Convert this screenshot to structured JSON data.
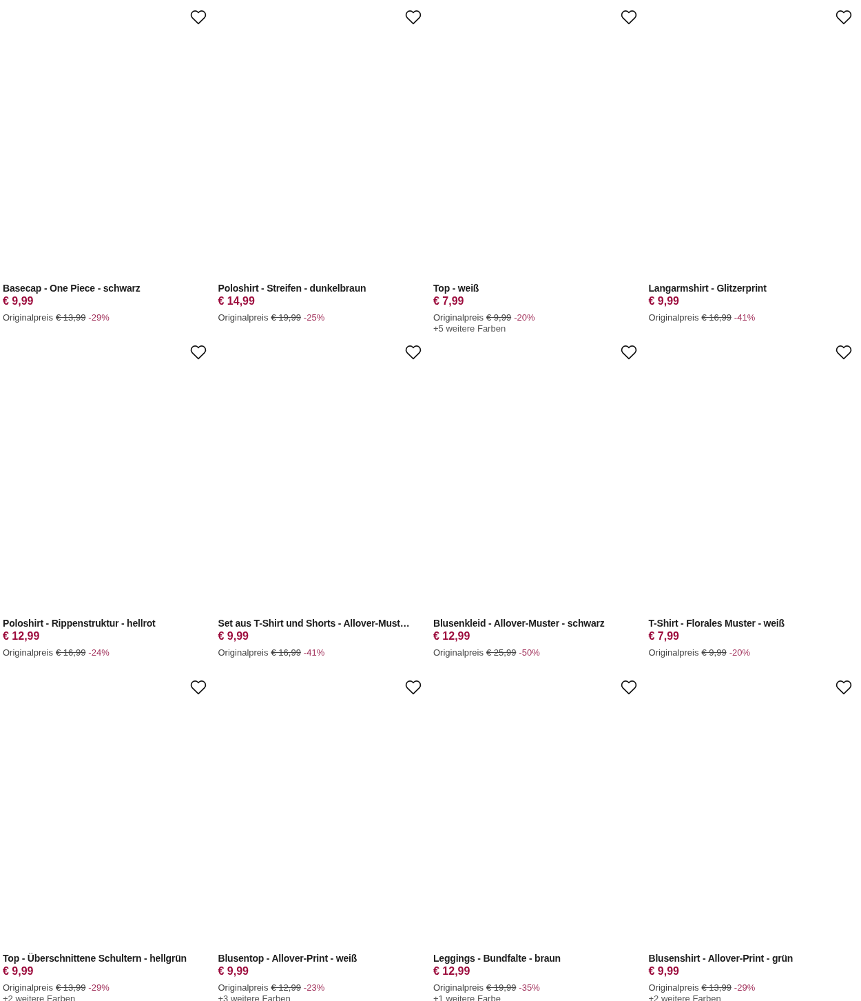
{
  "products": [
    {
      "name": "Basecap - One Piece - schwarz",
      "price": "€ 9,99",
      "original_price_label": "Originalpreis",
      "original_price": "€ 13,99",
      "discount": "-29%",
      "wishlisted": false
    },
    {
      "name": "Poloshirt - Streifen - dunkelbraun",
      "price": "€ 14,99",
      "original_price_label": "Originalpreis",
      "original_price": "€ 19,99",
      "discount": "-25%",
      "wishlisted": false
    },
    {
      "name": "Top - weiß",
      "price": "€ 7,99",
      "original_price_label": "Originalpreis",
      "original_price": "€ 9,99",
      "discount": "-20%",
      "more_colors": "+5 weitere Farben",
      "wishlisted": false
    },
    {
      "name": "Langarmshirt - Glitzerprint",
      "price": "€ 9,99",
      "original_price_label": "Originalpreis",
      "original_price": "€ 16,99",
      "discount": "-41%",
      "wishlisted": false
    },
    {
      "name": "Poloshirt - Rippenstruktur - hellrot",
      "price": "€ 12,99",
      "original_price_label": "Originalpreis",
      "original_price": "€ 16,99",
      "discount": "-24%",
      "wishlisted": false
    },
    {
      "name": "Set aus T-Shirt und Shorts - Allover-Must…",
      "price": "€ 9,99",
      "original_price_label": "Originalpreis",
      "original_price": "€ 16,99",
      "discount": "-41%",
      "wishlisted": false
    },
    {
      "name": "Blusenkleid - Allover-Muster - schwarz",
      "price": "€ 12,99",
      "original_price_label": "Originalpreis",
      "original_price": "€ 25,99",
      "discount": "-50%",
      "wishlisted": false
    },
    {
      "name": "T-Shirt - Florales Muster - weiß",
      "price": "€ 7,99",
      "original_price_label": "Originalpreis",
      "original_price": "€ 9,99",
      "discount": "-20%",
      "wishlisted": false
    },
    {
      "name": "Top - Überschnittene Schultern - hellgrün",
      "price": "€ 9,99",
      "original_price_label": "Originalpreis",
      "original_price": "€ 13,99",
      "discount": "-29%",
      "more_colors": "+2 weitere Farben",
      "wishlisted": false
    },
    {
      "name": "Blusentop - Allover-Print - weiß",
      "price": "€ 9,99",
      "original_price_label": "Originalpreis",
      "original_price": "€ 12,99",
      "discount": "-23%",
      "more_colors": "+3 weitere Farben",
      "wishlisted": false
    },
    {
      "name": "Leggings - Bundfalte - braun",
      "price": "€ 12,99",
      "original_price_label": "Originalpreis",
      "original_price": "€ 19,99",
      "discount": "-35%",
      "more_colors": "+1 weitere Farbe",
      "wishlisted": false
    },
    {
      "name": "Blusenshirt - Allover-Print - grün",
      "price": "€ 9,99",
      "original_price_label": "Originalpreis",
      "original_price": "€ 13,99",
      "discount": "-29%",
      "more_colors": "+2 weitere Farben",
      "wishlisted": false
    }
  ]
}
